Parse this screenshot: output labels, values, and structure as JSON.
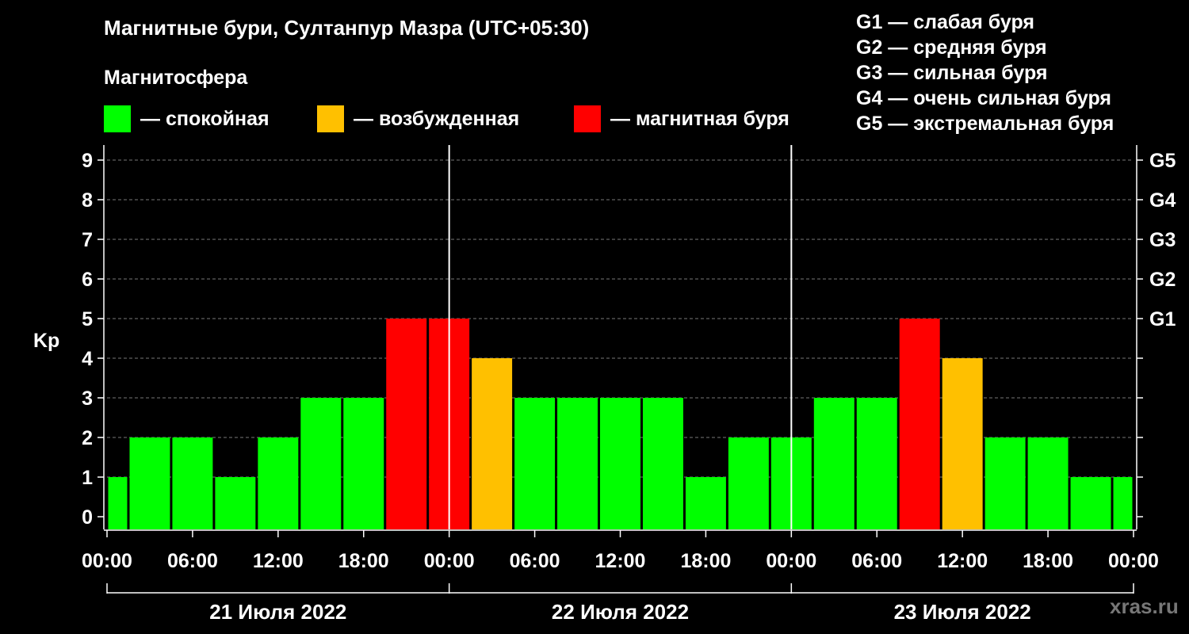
{
  "chart_data": {
    "type": "bar",
    "title": "Магнитные бури, Султанпур Мазра (UTC+05:30)",
    "subtitle": "Магнитосфера",
    "ylabel": "Kp",
    "ylim": [
      0,
      9
    ],
    "yticks": [
      "0",
      "1",
      "2",
      "3",
      "4",
      "5",
      "6",
      "7",
      "8",
      "9"
    ],
    "right_ticks": [
      {
        "value": 5,
        "label": "G1"
      },
      {
        "value": 6,
        "label": "G2"
      },
      {
        "value": 7,
        "label": "G3"
      },
      {
        "value": 8,
        "label": "G4"
      },
      {
        "value": 9,
        "label": "G5"
      }
    ],
    "x_hours_total": 72,
    "xticks": [
      "00:00",
      "06:00",
      "12:00",
      "18:00",
      "00:00",
      "06:00",
      "12:00",
      "18:00",
      "00:00",
      "06:00",
      "12:00",
      "18:00",
      "00:00"
    ],
    "days": [
      "21 Июля 2022",
      "22 Июля 2022",
      "23 Июля 2022"
    ],
    "grid": "dashed horizontal",
    "bars": [
      {
        "start": 0,
        "end": 1.5,
        "value": 1,
        "level": "calm"
      },
      {
        "start": 1.5,
        "end": 4.5,
        "value": 2,
        "level": "calm"
      },
      {
        "start": 4.5,
        "end": 7.5,
        "value": 2,
        "level": "calm"
      },
      {
        "start": 7.5,
        "end": 10.5,
        "value": 1,
        "level": "calm"
      },
      {
        "start": 10.5,
        "end": 13.5,
        "value": 2,
        "level": "calm"
      },
      {
        "start": 13.5,
        "end": 16.5,
        "value": 3,
        "level": "calm"
      },
      {
        "start": 16.5,
        "end": 19.5,
        "value": 3,
        "level": "calm"
      },
      {
        "start": 19.5,
        "end": 22.5,
        "value": 5,
        "level": "storm"
      },
      {
        "start": 22.5,
        "end": 25.5,
        "value": 5,
        "level": "storm"
      },
      {
        "start": 25.5,
        "end": 28.5,
        "value": 4,
        "level": "excited"
      },
      {
        "start": 28.5,
        "end": 31.5,
        "value": 3,
        "level": "calm"
      },
      {
        "start": 31.5,
        "end": 34.5,
        "value": 3,
        "level": "calm"
      },
      {
        "start": 34.5,
        "end": 37.5,
        "value": 3,
        "level": "calm"
      },
      {
        "start": 37.5,
        "end": 40.5,
        "value": 3,
        "level": "calm"
      },
      {
        "start": 40.5,
        "end": 43.5,
        "value": 1,
        "level": "calm"
      },
      {
        "start": 43.5,
        "end": 46.5,
        "value": 2,
        "level": "calm"
      },
      {
        "start": 46.5,
        "end": 49.5,
        "value": 2,
        "level": "calm"
      },
      {
        "start": 49.5,
        "end": 52.5,
        "value": 3,
        "level": "calm"
      },
      {
        "start": 52.5,
        "end": 55.5,
        "value": 3,
        "level": "calm"
      },
      {
        "start": 55.5,
        "end": 58.5,
        "value": 5,
        "level": "storm"
      },
      {
        "start": 58.5,
        "end": 61.5,
        "value": 4,
        "level": "excited"
      },
      {
        "start": 61.5,
        "end": 64.5,
        "value": 2,
        "level": "calm"
      },
      {
        "start": 64.5,
        "end": 67.5,
        "value": 2,
        "level": "calm"
      },
      {
        "start": 67.5,
        "end": 70.5,
        "value": 1,
        "level": "calm"
      },
      {
        "start": 70.5,
        "end": 72,
        "value": 1,
        "level": "calm"
      }
    ]
  },
  "legend": {
    "magnetosphere": [
      {
        "key": "calm",
        "label": "— спокойная",
        "color": "#00ff00"
      },
      {
        "key": "excited",
        "label": "— возбужденная",
        "color": "#ffc000"
      },
      {
        "key": "storm",
        "label": "— магнитная буря",
        "color": "#ff0000"
      }
    ],
    "g_scale": [
      "G1 — слабая буря",
      "G2 — средняя буря",
      "G3 — сильная буря",
      "G4 — очень сильная буря",
      "G5 — экстремальная буря"
    ]
  },
  "watermark": "xras.ru"
}
